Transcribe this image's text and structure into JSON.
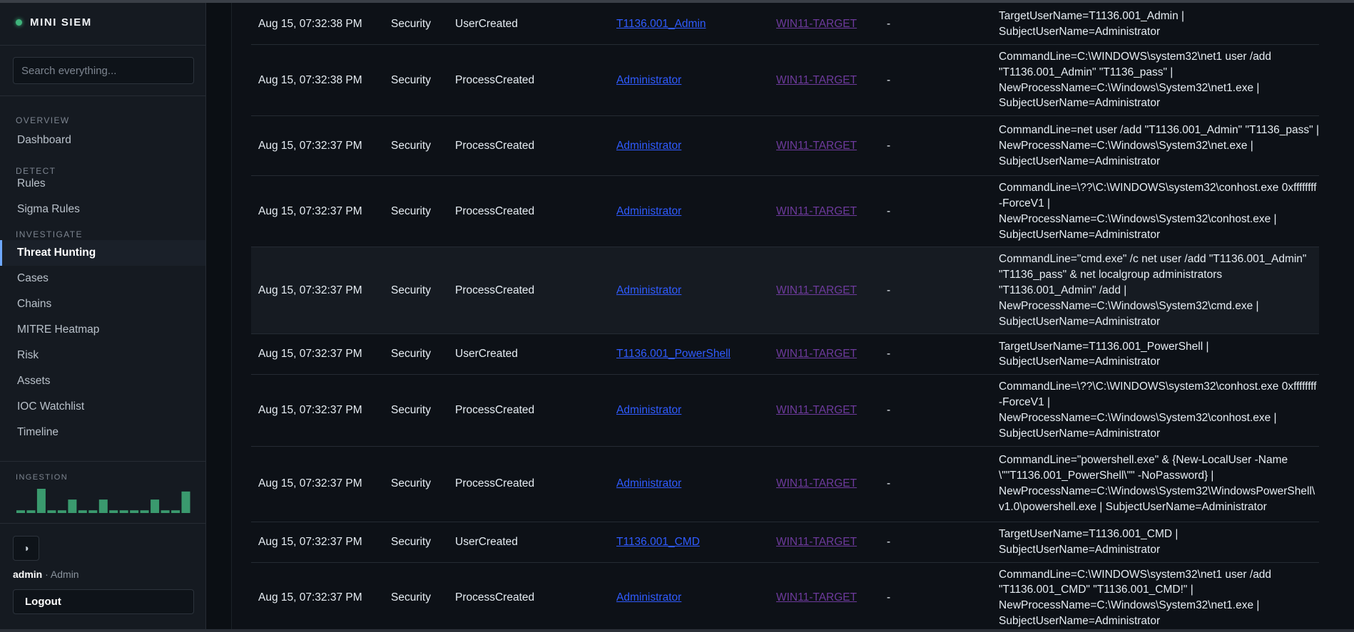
{
  "brand": {
    "title": "MINI SIEM"
  },
  "search": {
    "placeholder": "Search everything..."
  },
  "nav": {
    "overview_label": "OVERVIEW",
    "detect_label": "DETECT",
    "investigate_label": "INVESTIGATE",
    "items": {
      "dashboard": "Dashboard",
      "rules": "Rules",
      "sigma_rules": "Sigma Rules",
      "threat_hunting": "Threat Hunting",
      "cases": "Cases",
      "chains": "Chains",
      "mitre_heatmap": "MITRE Heatmap",
      "risk": "Risk",
      "assets": "Assets",
      "ioc_watchlist": "IOC Watchlist",
      "timeline": "Timeline"
    }
  },
  "ingestion": {
    "label": "INGESTION",
    "bar_color": "#3a9a6e",
    "values": [
      1,
      1,
      9,
      1,
      1,
      5,
      1,
      1,
      5,
      1,
      1,
      1,
      1,
      5,
      1,
      1,
      8
    ]
  },
  "footer": {
    "theme_icon": "◑",
    "username": "admin",
    "separator": " · ",
    "role": "Admin",
    "logout_label": "Logout"
  },
  "colors": {
    "accent": "#6ea8fe",
    "status_dot": "#3fb57c",
    "link_user": "#2f5bff",
    "link_host": "#6d3a9c"
  },
  "events": {
    "rows": [
      {
        "time": "Aug 15, 07:32:38 PM",
        "source": "Security",
        "event": "UserCreated",
        "user": "T1136.001_Admin",
        "host": "WIN11-TARGET",
        "extra": "-",
        "details": "TargetUserName=T1136.001_Admin | SubjectUserName=Administrator"
      },
      {
        "time": "Aug 15, 07:32:38 PM",
        "source": "Security",
        "event": "ProcessCreated",
        "user": "Administrator",
        "host": "WIN11-TARGET",
        "extra": "-",
        "details": "CommandLine=C:\\WINDOWS\\system32\\net1 user /add \"T1136.001_Admin\" \"T1136_pass\" | NewProcessName=C:\\Windows\\System32\\net1.exe | SubjectUserName=Administrator"
      },
      {
        "time": "Aug 15, 07:32:37 PM",
        "source": "Security",
        "event": "ProcessCreated",
        "user": "Administrator",
        "host": "WIN11-TARGET",
        "extra": "-",
        "details": "CommandLine=net user /add \"T1136.001_Admin\" \"T1136_pass\" | NewProcessName=C:\\Windows\\System32\\net.exe | SubjectUserName=Administrator"
      },
      {
        "time": "Aug 15, 07:32:37 PM",
        "source": "Security",
        "event": "ProcessCreated",
        "user": "Administrator",
        "host": "WIN11-TARGET",
        "extra": "-",
        "details": "CommandLine=\\??\\C:\\WINDOWS\\system32\\conhost.exe 0xffffffff -ForceV1 | NewProcessName=C:\\Windows\\System32\\conhost.exe | SubjectUserName=Administrator"
      },
      {
        "time": "Aug 15, 07:32:37 PM",
        "source": "Security",
        "event": "ProcessCreated",
        "user": "Administrator",
        "host": "WIN11-TARGET",
        "extra": "-",
        "details": "CommandLine=\"cmd.exe\" /c net user /add \"T1136.001_Admin\" \"T1136_pass\" & net localgroup administrators \"T1136.001_Admin\" /add | NewProcessName=C:\\Windows\\System32\\cmd.exe | SubjectUserName=Administrator"
      },
      {
        "time": "Aug 15, 07:32:37 PM",
        "source": "Security",
        "event": "UserCreated",
        "user": "T1136.001_PowerShell",
        "host": "WIN11-TARGET",
        "extra": "-",
        "details": "TargetUserName=T1136.001_PowerShell | SubjectUserName=Administrator"
      },
      {
        "time": "Aug 15, 07:32:37 PM",
        "source": "Security",
        "event": "ProcessCreated",
        "user": "Administrator",
        "host": "WIN11-TARGET",
        "extra": "-",
        "details": "CommandLine=\\??\\C:\\WINDOWS\\system32\\conhost.exe 0xffffffff -ForceV1 | NewProcessName=C:\\Windows\\System32\\conhost.exe | SubjectUserName=Administrator"
      },
      {
        "time": "Aug 15, 07:32:37 PM",
        "source": "Security",
        "event": "ProcessCreated",
        "user": "Administrator",
        "host": "WIN11-TARGET",
        "extra": "-",
        "details": "CommandLine=\"powershell.exe\" & {New-LocalUser -Name \\\"\"T1136.001_PowerShell\\\"\" -NoPassword} | NewProcessName=C:\\Windows\\System32\\WindowsPowerShell\\v1.0\\powershell.exe | SubjectUserName=Administrator"
      },
      {
        "time": "Aug 15, 07:32:37 PM",
        "source": "Security",
        "event": "UserCreated",
        "user": "T1136.001_CMD",
        "host": "WIN11-TARGET",
        "extra": "-",
        "details": "TargetUserName=T1136.001_CMD | SubjectUserName=Administrator"
      },
      {
        "time": "Aug 15, 07:32:37 PM",
        "source": "Security",
        "event": "ProcessCreated",
        "user": "Administrator",
        "host": "WIN11-TARGET",
        "extra": "-",
        "details": "CommandLine=C:\\WINDOWS\\system32\\net1 user /add \"T1136.001_CMD\" \"T1136.001_CMD!\" | NewProcessName=C:\\Windows\\System32\\net1.exe | SubjectUserName=Administrator"
      }
    ]
  }
}
